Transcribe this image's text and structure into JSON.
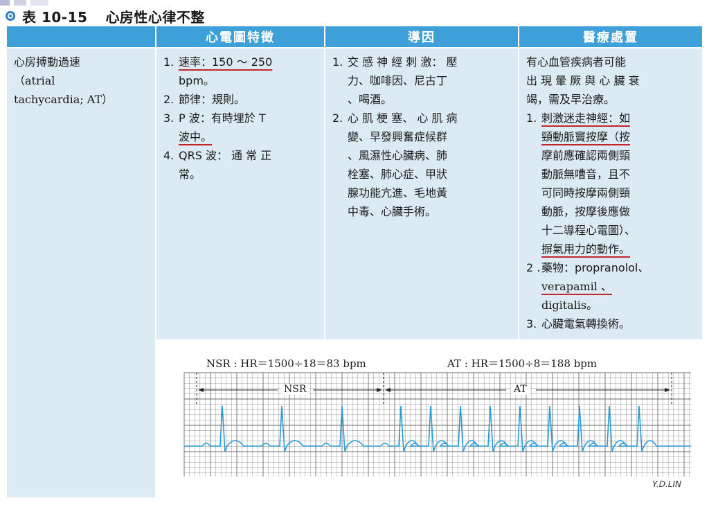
{
  "title": {
    "number_label": "表 10-15",
    "text": "心房性心律不整"
  },
  "columns": {
    "ecg_features": "心電圖特徵",
    "causes": "導因",
    "treatment": "醫療處置"
  },
  "row": {
    "name_zh": "心房搏動過速",
    "name_en_open": "（atrial",
    "name_en_close": "tachycardia; AT）"
  },
  "ecg_features": [
    {
      "num": "1.",
      "lines": [
        "速率：150 ～ 250",
        "bpm。"
      ]
    },
    {
      "num": "2.",
      "lines": [
        "節律：規則。"
      ]
    },
    {
      "num": "3.",
      "lines": [
        "P 波：有時埋於 T",
        "波中。"
      ]
    },
    {
      "num": "4.",
      "lines": [
        "QRS 波： 通 常 正",
        "常。"
      ]
    }
  ],
  "causes": [
    {
      "num": "1.",
      "lines": [
        "交 感 神 經 刺 激： 壓",
        "力、咖啡因、尼古丁",
        "、喝酒。"
      ]
    },
    {
      "num": "2.",
      "lines": [
        "心 肌 梗 塞、 心 肌 病",
        "變、早發興奮症候群",
        "、風濕性心臟病、肺",
        "栓塞、肺心症、甲狀",
        "腺功能亢進、毛地黃",
        "中毒、心臟手術。"
      ]
    }
  ],
  "treatment": {
    "intro": [
      "有心血管疾病者可能",
      "出 現 暈 厥 與 心 臟 衰",
      "竭，需及早治療。"
    ],
    "item1": {
      "num": "1.",
      "lines": [
        "刺激迷走神經：如",
        "頸動脈竇按摩（按",
        "摩前應確認兩側頸",
        "動脈無嘈音，且不",
        "可同時按摩兩側頸",
        "動脈，按摩後應做",
        "十二導程心電圖）、",
        "摒氣用力的動作。"
      ]
    },
    "item2": {
      "num": "2 .",
      "lines": [
        "藥物：propranolol、",
        "verapamil 、",
        "digitalis。"
      ]
    },
    "item3": {
      "num": "3.",
      "lines": [
        "心臟電氣轉換術。"
      ]
    }
  },
  "ecg_strip": {
    "caption_nsr": "NSR : HR＝1500÷18＝83 bpm",
    "caption_at": "AT : HR＝1500÷8＝188 bpm",
    "label_nsr": "NSR",
    "label_at": "AT",
    "signature": "Y.D.LIN",
    "grid_color": "#6b6b6b",
    "trace_color": "#2a9bd7"
  },
  "colors": {
    "header_bg": "#3da0d8",
    "cell_bg": "#dbeaf3",
    "underline": "#c0272d"
  }
}
